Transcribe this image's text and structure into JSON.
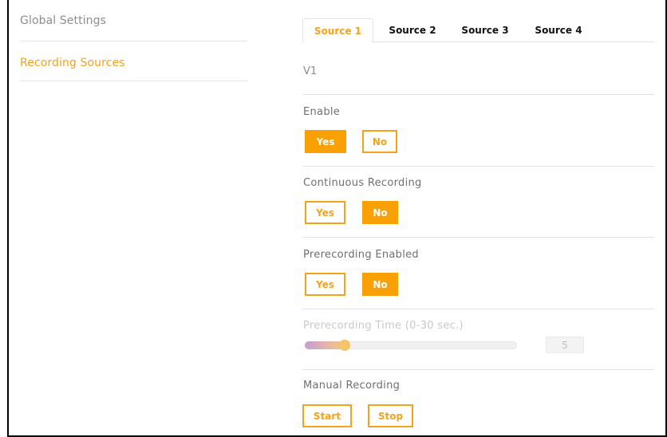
{
  "sidebar": {
    "items": [
      {
        "label": "Global Settings",
        "active": false
      },
      {
        "label": "Recording Sources",
        "active": true
      }
    ]
  },
  "tabs": [
    {
      "label": "Source 1",
      "active": true
    },
    {
      "label": "Source 2",
      "active": false
    },
    {
      "label": "Source 3",
      "active": false
    },
    {
      "label": "Source 4",
      "active": false
    }
  ],
  "source": {
    "name": "V1",
    "enable": {
      "label": "Enable",
      "yes": "Yes",
      "no": "No",
      "selected": "Yes"
    },
    "continuous": {
      "label": "Continuous Recording",
      "yes": "Yes",
      "no": "No",
      "selected": "No"
    },
    "prerecording": {
      "label": "Prerecording Enabled",
      "yes": "Yes",
      "no": "No",
      "selected": "No"
    },
    "prerecording_time": {
      "label": "Prerecording Time (0-30 sec.)",
      "value": "5",
      "min": 0,
      "max": 30,
      "disabled": true
    },
    "manual": {
      "label": "Manual Recording",
      "start": "Start",
      "stop": "Stop"
    }
  },
  "colors": {
    "accent": "#f9a104",
    "accent_text": "#f5a21b",
    "muted_text": "#8d8d8d"
  }
}
